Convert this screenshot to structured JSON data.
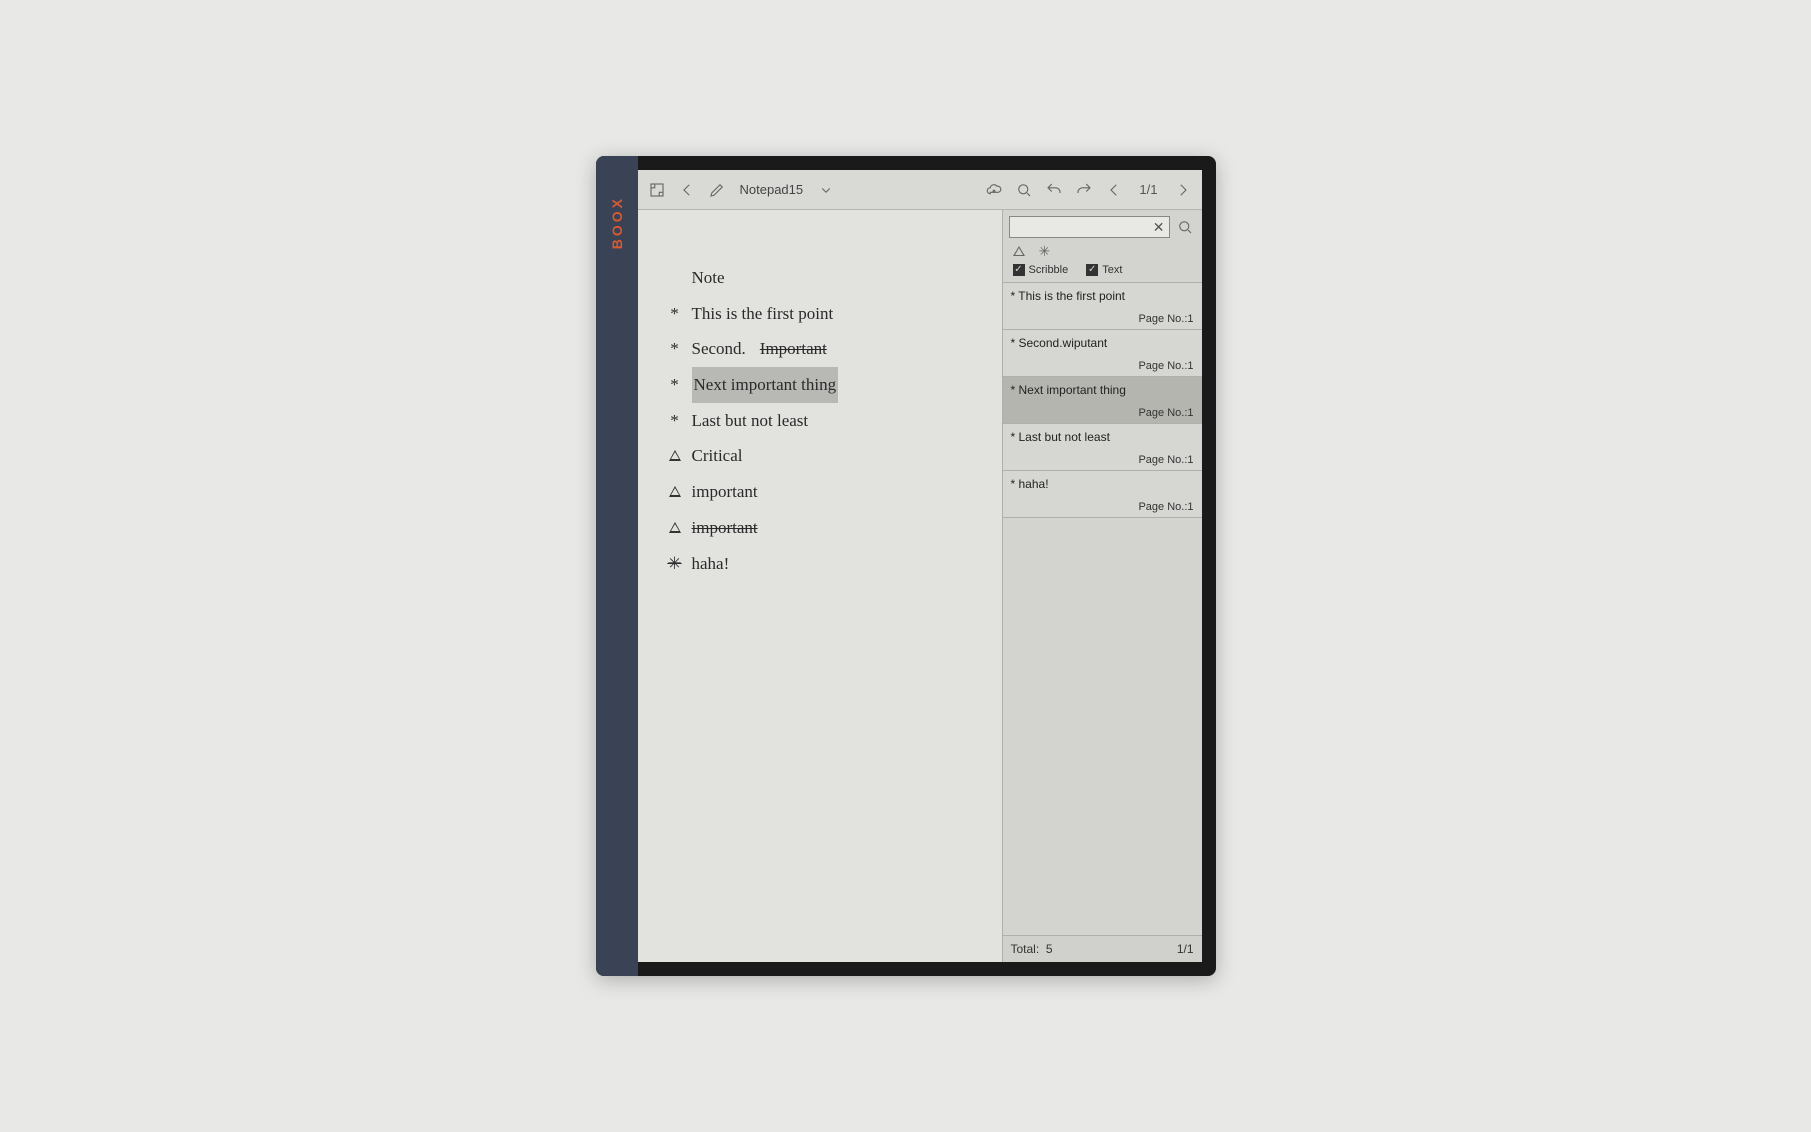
{
  "device": {
    "brand": "BOOX"
  },
  "toolbar": {
    "title": "Notepad15",
    "page_indicator": "1/1"
  },
  "canvas": {
    "heading": "Note",
    "lines": [
      {
        "bullet": "*",
        "text": "This is the first point",
        "selected": false
      },
      {
        "bullet": "*",
        "text": "Second.",
        "suffix_strike": "Important",
        "selected": false
      },
      {
        "bullet": "*",
        "text": "Next important thing",
        "selected": true
      },
      {
        "bullet": "*",
        "text": "Last but not least",
        "selected": false
      },
      {
        "bullet": "△",
        "text": "Critical",
        "selected": false
      },
      {
        "bullet": "△",
        "text": "important",
        "selected": false
      },
      {
        "bullet": "△",
        "text": "important",
        "strike_self": true,
        "selected": false
      },
      {
        "bullet": "✳",
        "text": "haha!",
        "strike_bullet": true,
        "selected": false
      }
    ]
  },
  "search_panel": {
    "search_value": "",
    "filters": {
      "scribble": {
        "label": "Scribble",
        "checked": true
      },
      "text": {
        "label": "Text",
        "checked": true
      }
    },
    "results": [
      {
        "title": "* This is the first point",
        "page_label": "Page No.:1",
        "selected": false
      },
      {
        "title": "* Second.wiputant",
        "page_label": "Page No.:1",
        "selected": false
      },
      {
        "title": "* Next important thing",
        "page_label": "Page No.:1",
        "selected": true
      },
      {
        "title": "* Last but not least",
        "page_label": "Page No.:1",
        "selected": false
      },
      {
        "title": "* haha!",
        "page_label": "Page No.:1",
        "selected": false
      }
    ],
    "footer": {
      "total_label": "Total:",
      "total_value": "5",
      "page": "1/1"
    }
  }
}
